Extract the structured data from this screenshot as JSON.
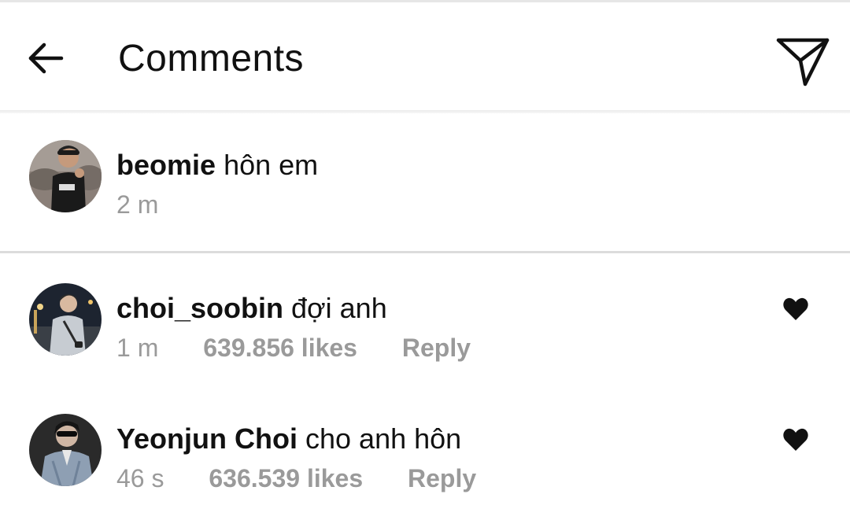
{
  "header": {
    "title": "Comments",
    "back_icon": "arrow-left-icon",
    "send_icon": "paper-plane-icon"
  },
  "caption": {
    "username": "beomie",
    "text": "hôn em",
    "time": "2 m"
  },
  "comments": [
    {
      "username": "choi_soobin",
      "text": "đợi anh",
      "time": "1 m",
      "likes": "639.856 likes",
      "reply_label": "Reply",
      "liked": true
    },
    {
      "username": "Yeonjun Choi",
      "text": "cho anh hôn",
      "time": "46 s",
      "likes": "636.539 likes",
      "reply_label": "Reply",
      "liked": true
    }
  ],
  "colors": {
    "text": "#111111",
    "meta": "#9a9a9a",
    "divider": "#dcdcdc",
    "heart": "#111111"
  }
}
